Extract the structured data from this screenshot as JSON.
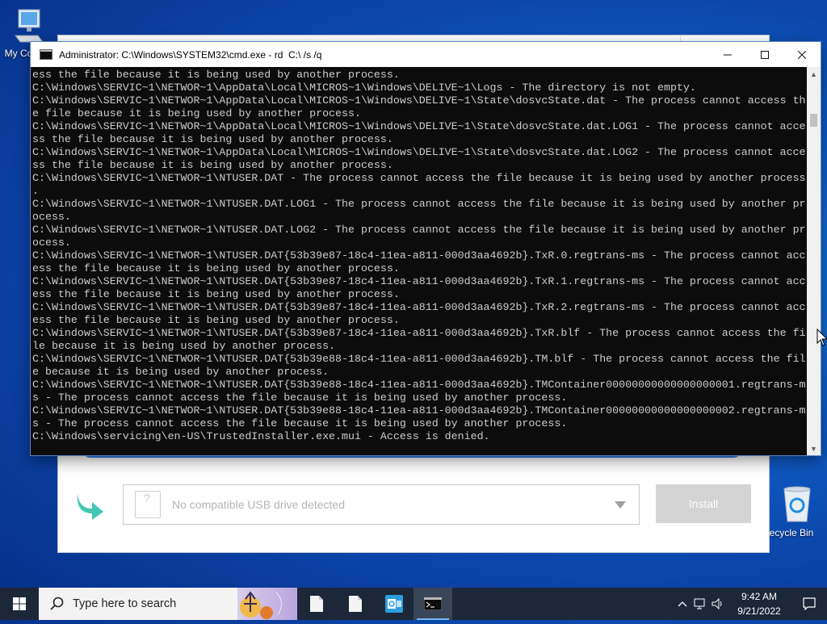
{
  "desktop": {
    "icons": [
      {
        "label": "My Co"
      },
      {
        "label": "ecycle Bin"
      }
    ]
  },
  "installer": {
    "usb_placeholder": "No compatible USB drive detected",
    "install_label": "Install"
  },
  "cmd_window": {
    "title": "Administrator: C:\\Windows\\SYSTEM32\\cmd.exe - rd  C:\\ /s /q",
    "lines": [
      "ess the file because it is being used by another process.",
      "C:\\Windows\\SERVIC~1\\NETWOR~1\\AppData\\Local\\MICROS~1\\Windows\\DELIVE~1\\Logs - The directory is not empty.",
      "C:\\Windows\\SERVIC~1\\NETWOR~1\\AppData\\Local\\MICROS~1\\Windows\\DELIVE~1\\State\\dosvcState.dat - The process cannot access th",
      "e file because it is being used by another process.",
      "C:\\Windows\\SERVIC~1\\NETWOR~1\\AppData\\Local\\MICROS~1\\Windows\\DELIVE~1\\State\\dosvcState.dat.LOG1 - The process cannot acce",
      "ss the file because it is being used by another process.",
      "C:\\Windows\\SERVIC~1\\NETWOR~1\\AppData\\Local\\MICROS~1\\Windows\\DELIVE~1\\State\\dosvcState.dat.LOG2 - The process cannot acce",
      "ss the file because it is being used by another process.",
      "C:\\Windows\\SERVIC~1\\NETWOR~1\\NTUSER.DAT - The process cannot access the file because it is being used by another process",
      ".",
      "C:\\Windows\\SERVIC~1\\NETWOR~1\\NTUSER.DAT.LOG1 - The process cannot access the file because it is being used by another pr",
      "ocess.",
      "C:\\Windows\\SERVIC~1\\NETWOR~1\\NTUSER.DAT.LOG2 - The process cannot access the file because it is being used by another pr",
      "ocess.",
      "C:\\Windows\\SERVIC~1\\NETWOR~1\\NTUSER.DAT{53b39e87-18c4-11ea-a811-000d3aa4692b}.TxR.0.regtrans-ms - The process cannot acc",
      "ess the file because it is being used by another process.",
      "C:\\Windows\\SERVIC~1\\NETWOR~1\\NTUSER.DAT{53b39e87-18c4-11ea-a811-000d3aa4692b}.TxR.1.regtrans-ms - The process cannot acc",
      "ess the file because it is being used by another process.",
      "C:\\Windows\\SERVIC~1\\NETWOR~1\\NTUSER.DAT{53b39e87-18c4-11ea-a811-000d3aa4692b}.TxR.2.regtrans-ms - The process cannot acc",
      "ess the file because it is being used by another process.",
      "C:\\Windows\\SERVIC~1\\NETWOR~1\\NTUSER.DAT{53b39e87-18c4-11ea-a811-000d3aa4692b}.TxR.blf - The process cannot access the fi",
      "le because it is being used by another process.",
      "C:\\Windows\\SERVIC~1\\NETWOR~1\\NTUSER.DAT{53b39e88-18c4-11ea-a811-000d3aa4692b}.TM.blf - The process cannot access the fil",
      "e because it is being used by another process.",
      "C:\\Windows\\SERVIC~1\\NETWOR~1\\NTUSER.DAT{53b39e88-18c4-11ea-a811-000d3aa4692b}.TMContainer00000000000000000001.regtrans-m",
      "s - The process cannot access the file because it is being used by another process.",
      "C:\\Windows\\SERVIC~1\\NETWOR~1\\NTUSER.DAT{53b39e88-18c4-11ea-a811-000d3aa4692b}.TMContainer00000000000000000002.regtrans-m",
      "s - The process cannot access the file because it is being used by another process.",
      "C:\\Windows\\servicing\\en-US\\TrustedInstaller.exe.mui - Access is denied."
    ]
  },
  "taskbar": {
    "search_placeholder": "Type here to search",
    "apps": [
      {
        "icon": "file-icon"
      },
      {
        "icon": "file-icon"
      },
      {
        "icon": "outlook-icon"
      },
      {
        "icon": "cmd-icon",
        "active": true
      }
    ],
    "clock_time": "9:42 AM",
    "clock_date": "9/21/2022"
  },
  "colors": {
    "console_bg": "#0c0c0c",
    "console_text": "#cccccc",
    "taskbar_bg": "#1c2738",
    "accent": "#2d7be0"
  }
}
